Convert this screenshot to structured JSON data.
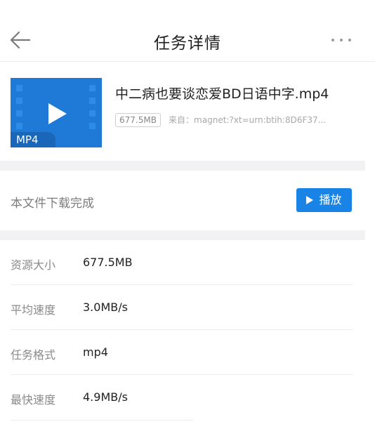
{
  "header": {
    "title": "任务详情",
    "back_icon": "back-arrow-icon",
    "more_icon": "more-dots-icon"
  },
  "file": {
    "name": "中二病也要谈恋爱BD日语中字.mp4",
    "size_tag": "677.5MB",
    "source": "来自：magnet:?xt=urn:btih:8D6F37...",
    "thumb_badge": "MP4",
    "thumb_color": "#1f79d6",
    "thumb_icon": "video-file-icon"
  },
  "status": {
    "text": "本文件下载完成",
    "play_label": "播放",
    "play_color": "#1a84e6"
  },
  "info": [
    {
      "label": "资源大小",
      "value": "677.5MB"
    },
    {
      "label": "平均速度",
      "value": "3.0MB/s"
    },
    {
      "label": "任务格式",
      "value": "mp4"
    },
    {
      "label": "最快速度",
      "value": "4.9MB/s"
    }
  ]
}
